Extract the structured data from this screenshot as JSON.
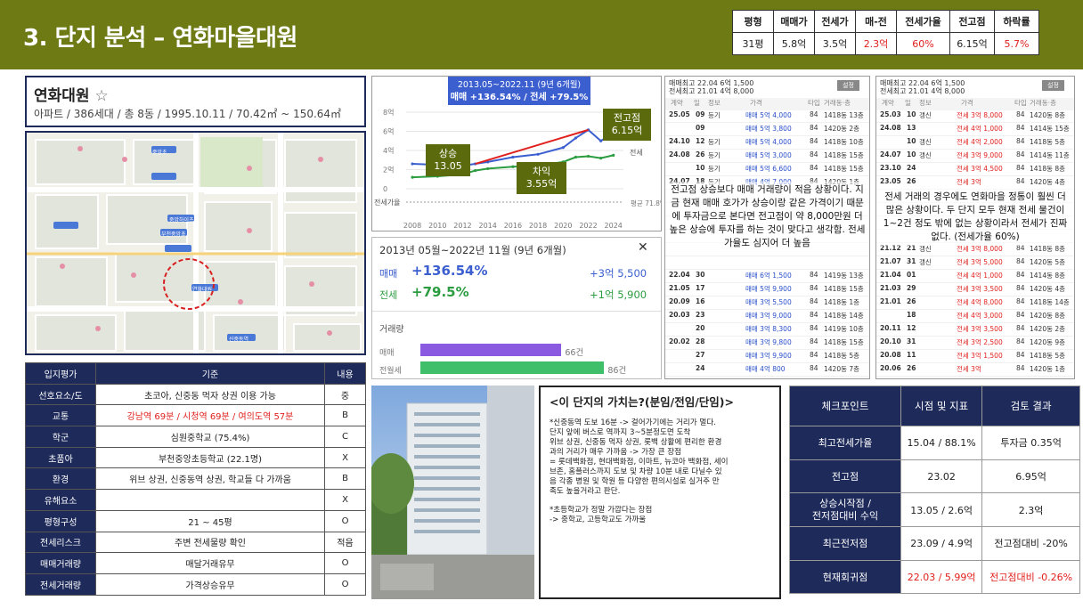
{
  "header": {
    "title": "3. 단지 분석 – 연화마을대원"
  },
  "summary": {
    "headers": [
      "평형",
      "매매가",
      "전세가",
      "매-전",
      "전세가율",
      "전고점",
      "하락률"
    ],
    "values": [
      "31평",
      "5.8억",
      "3.5억",
      "2.3억",
      "60%",
      "6.15억",
      "5.7%"
    ]
  },
  "apartment": {
    "name": "연화대원",
    "star": "☆",
    "info": "아파트 / 386세대 / 총 8동 / 1995.10.11 / 70.42㎡ ~ 150.64㎡"
  },
  "map": {
    "labels": [
      "중앙초",
      "부천중앙초",
      "중앙하이츠",
      "연화대원",
      "신중동역"
    ]
  },
  "location_table": {
    "headers": [
      "입지평가",
      "기준",
      "내용"
    ],
    "rows": [
      [
        "선호요소/도",
        "초코아, 신중동 먹자 상권 이용 가능",
        "중"
      ],
      [
        "교통",
        "강남역 69분 / 시청역 69분 / 여의도역 57분",
        "B"
      ],
      [
        "학군",
        "심원중학교 (75.4%)",
        "C"
      ],
      [
        "초품아",
        "부천중앙초등학교 (22.1명)",
        "X"
      ],
      [
        "환경",
        "위브 상권, 신중동역 상권, 학교들 다 가까움",
        "B"
      ],
      [
        "유해요소",
        "",
        "X"
      ],
      [
        "평형구성",
        "21 ~ 45평",
        "O"
      ],
      [
        "전세리스크",
        "주변 전세물량 확인",
        "적음"
      ],
      [
        "매매거래량",
        "매달거래유무",
        "O"
      ],
      [
        "전세거래량",
        "가격상승유무",
        "O"
      ]
    ]
  },
  "chart": {
    "type": "line",
    "banner_line1": "2013.05~2022.11 (9년 6개월)",
    "banner_line2": "매매 +136.54% / 전세 +79.5%",
    "y_ticks": [
      "8억",
      "6억",
      "4억",
      "2억",
      "0"
    ],
    "x_ticks": [
      "2008",
      "2010",
      "2012",
      "2014",
      "2016",
      "2018",
      "2020",
      "2022",
      "2024"
    ],
    "jeonse_rate_label": "전세가율",
    "jeonse_rate_value": "평균 71.8%",
    "series_label_sale": "매매",
    "series_label_jeonse": "전세",
    "chart_data": {
      "type": "line",
      "x": [
        2008,
        2010,
        2012,
        2013,
        2014,
        2016,
        2018,
        2020,
        2021,
        2022,
        2023,
        2024
      ],
      "series": [
        {
          "name": "매매",
          "values": [
            2.6,
            2.5,
            2.4,
            2.6,
            2.8,
            3.3,
            3.6,
            4.3,
            5.3,
            6.15,
            5.0,
            5.8
          ]
        },
        {
          "name": "전세",
          "values": [
            1.2,
            1.3,
            1.5,
            1.9,
            2.1,
            2.3,
            2.4,
            2.8,
            3.3,
            3.4,
            3.2,
            3.5
          ]
        }
      ],
      "ylim": [
        0,
        8
      ]
    }
  },
  "callouts": {
    "peak": "전고점\n6.15억",
    "rise": "상승\n13.05",
    "gap": "차익\n3.55억"
  },
  "stats": {
    "period": "2013년 05월~2022년 11월 (9년 6개월)",
    "close": "✕",
    "sale_label": "매매",
    "sale_pct": "+136.54%",
    "sale_amount": "+3억 5,500",
    "jeonse_label": "전세",
    "jeonse_pct": "+79.5%",
    "jeonse_amount": "+1억 5,900",
    "volume_title": "거래량",
    "vol_sale_label": "매매",
    "vol_sale_count": "66건",
    "vol_jeonse_label": "전월세",
    "vol_jeonse_count": "86건",
    "vol_sale_ratio": 0.66,
    "vol_jeonse_ratio": 0.86
  },
  "list1": {
    "top1": "매매최고 22.04 6억 1,500",
    "top2": "전세최고 21.01 4억 8,000",
    "button": "설정",
    "headers": [
      "계약",
      "일",
      "정보",
      "가격",
      "타입",
      "거래동·층"
    ],
    "rows": [
      [
        "25.05",
        "09",
        "등기",
        "매매 5억 4,000",
        "84",
        "1418동 13층"
      ],
      [
        "",
        "09",
        "",
        "매매 5억 3,800",
        "84",
        "1420동 2층"
      ],
      [
        "24.10",
        "12",
        "등기",
        "매매 5억 4,000",
        "84",
        "1418동 10층"
      ],
      [
        "24.08",
        "26",
        "등기",
        "매매 5억 3,000",
        "84",
        "1418동 15층"
      ],
      [
        "",
        "10",
        "등기",
        "매매 5억 6,600",
        "84",
        "1418동 15층"
      ],
      [
        "24.07",
        "18",
        "등기",
        "매매 4억 7,000",
        "84",
        "1420동 1층"
      ],
      [
        "",
        "",
        "",
        "",
        "",
        ""
      ],
      [
        "",
        "",
        "",
        "",
        "",
        ""
      ],
      [
        "",
        "",
        "",
        "",
        "",
        ""
      ],
      [
        "",
        "",
        "",
        "",
        "",
        ""
      ],
      [
        "",
        "",
        "",
        "",
        "",
        ""
      ],
      [
        "",
        "",
        "",
        "",
        "",
        ""
      ],
      [
        "22.04",
        "30",
        "",
        "매매 6억 1,500",
        "84",
        "1419동 13층"
      ],
      [
        "21.05",
        "17",
        "",
        "매매 5억 9,900",
        "84",
        "1418동 15층"
      ],
      [
        "20.09",
        "16",
        "",
        "매매 3억 5,500",
        "84",
        "1418동 1층"
      ],
      [
        "20.03",
        "23",
        "",
        "매매 3억 9,000",
        "84",
        "1418동 14층"
      ],
      [
        "",
        "20",
        "",
        "매매 3억 8,300",
        "84",
        "1419동 10층"
      ],
      [
        "20.02",
        "28",
        "",
        "매매 3억 9,800",
        "84",
        "1418동 15층"
      ],
      [
        "",
        "27",
        "",
        "매매 3억 9,900",
        "84",
        "1418동 5층"
      ],
      [
        "",
        "24",
        "",
        "매매 4억 800",
        "84",
        "1420동 7층"
      ]
    ],
    "note": "전고점 상승보다 매매 거래량이 적음 상황이다. 지금 현재 매매 호가가 상승이랑 같은 가격이기 때문에 투자금으로 본다면 전고점이 약 8,000만원 더 높은 상승에 투자를 하는 것이 맞다고 생각함. 전세가율도 심지어 더 높음"
  },
  "list2": {
    "top1": "매매최고 22.04 6억 1,500",
    "top2": "전세최고 21.01 4억 8,000",
    "button": "설정",
    "headers": [
      "계약",
      "일",
      "정보",
      "가격",
      "타입",
      "거래동·층"
    ],
    "rows": [
      [
        "25.03",
        "10",
        "갱신",
        "전세 3억 8,000",
        "84",
        "1420동 8층"
      ],
      [
        "24.08",
        "13",
        "",
        "전세 4억 1,000",
        "84",
        "1414동 15층"
      ],
      [
        "",
        "10",
        "갱신",
        "전세 4억 2,000",
        "84",
        "1418동 5층"
      ],
      [
        "24.07",
        "10",
        "갱신",
        "전세 3억 9,000",
        "84",
        "1414동 11층"
      ],
      [
        "23.10",
        "24",
        "",
        "전세 3억 4,500",
        "84",
        "1418동 8층"
      ],
      [
        "23.05",
        "26",
        "",
        "전세 3억",
        "84",
        "1420동 4층"
      ],
      [
        "",
        "",
        "",
        "",
        "",
        ""
      ],
      [
        "",
        "",
        "",
        "",
        "",
        ""
      ],
      [
        "",
        "",
        "",
        "",
        "",
        ""
      ],
      [
        "",
        "",
        "",
        "",
        "",
        ""
      ],
      [
        "21.12",
        "21",
        "갱신",
        "전세 3억 8,000",
        "84",
        "1418동 8층"
      ],
      [
        "21.07",
        "31",
        "갱신",
        "전세 3억 5,000",
        "84",
        "1420동 5층"
      ],
      [
        "21.04",
        "01",
        "",
        "전세 4억 1,000",
        "84",
        "1414동 8층"
      ],
      [
        "21.03",
        "29",
        "",
        "전세 3억 3,500",
        "84",
        "1420동 4층"
      ],
      [
        "21.01",
        "26",
        "",
        "전세 4억 8,000",
        "84",
        "1418동 14층"
      ],
      [
        "",
        "18",
        "",
        "전세 4억 3,000",
        "84",
        "1420동 8층"
      ],
      [
        "20.11",
        "12",
        "",
        "전세 3억 3,500",
        "84",
        "1420동 2층"
      ],
      [
        "20.10",
        "31",
        "",
        "전세 3억 2,500",
        "84",
        "1420동 9층"
      ],
      [
        "20.08",
        "11",
        "",
        "전세 3억 1,500",
        "84",
        "1418동 5층"
      ],
      [
        "20.06",
        "26",
        "",
        "전세 3억",
        "84",
        "1420동 1층"
      ]
    ],
    "note": "전세 거래의 경우에도 연화마을 정통이 훨씬 더 많은 상황이다. 두 단지 모두 현재 전세 물건이 1~2건 정도 밖에 없는 상황이라서 전세가 진짜 없다. (전세가율 60%)"
  },
  "value_box": {
    "title": "<이 단지의 가치는?(분임/전임/단임)>",
    "lines": [
      "*신중동역 도보 16분 -> 걸어가기에는 거리가 멀다.",
      "단지 앞에 버스로 역까지 3~5분정도면 도착",
      "위브 상권, 신중동 먹자 상권, 롯백 상활에 편리한 환경",
      "과의 거리가 매우 가까움 -> 가장 큰 장점",
      "= 롯데백화점, 현대백화점, 이마트, 뉴코아 백화점, 세이",
      "브존, 홈플러스까지 도보 및 차량 10분 내로 다닐수 있",
      "음 각종 병원 및 학원 등 다양한 편의시설로 실거주 만",
      "족도 높을거라고 판단.",
      "",
      "*초등학교가 정말 가깝다는 장점",
      "-> 중학교, 고등학교도 가까울"
    ]
  },
  "check_table": {
    "headers": [
      "체크포인트",
      "시점 및 지표",
      "검토 결과"
    ],
    "rows": [
      [
        "최고전세가율",
        "15.04 / 88.1%",
        "투자금 0.35억"
      ],
      [
        "전고점",
        "23.02",
        "6.95억"
      ],
      [
        "상승시작점 /\n전저점대비 수익",
        "13.05 / 2.6억",
        "2.3억"
      ],
      [
        "최근전저점",
        "23.09 / 4.9억",
        "전고점대비 -20%"
      ],
      [
        "현재회귀점",
        "22.03 / 5.99억",
        "전고점대비 -0.26%"
      ]
    ]
  },
  "colors": {
    "header": "#6e7a14",
    "navy": "#1d2a5a",
    "accent_red": "#e0201c"
  }
}
